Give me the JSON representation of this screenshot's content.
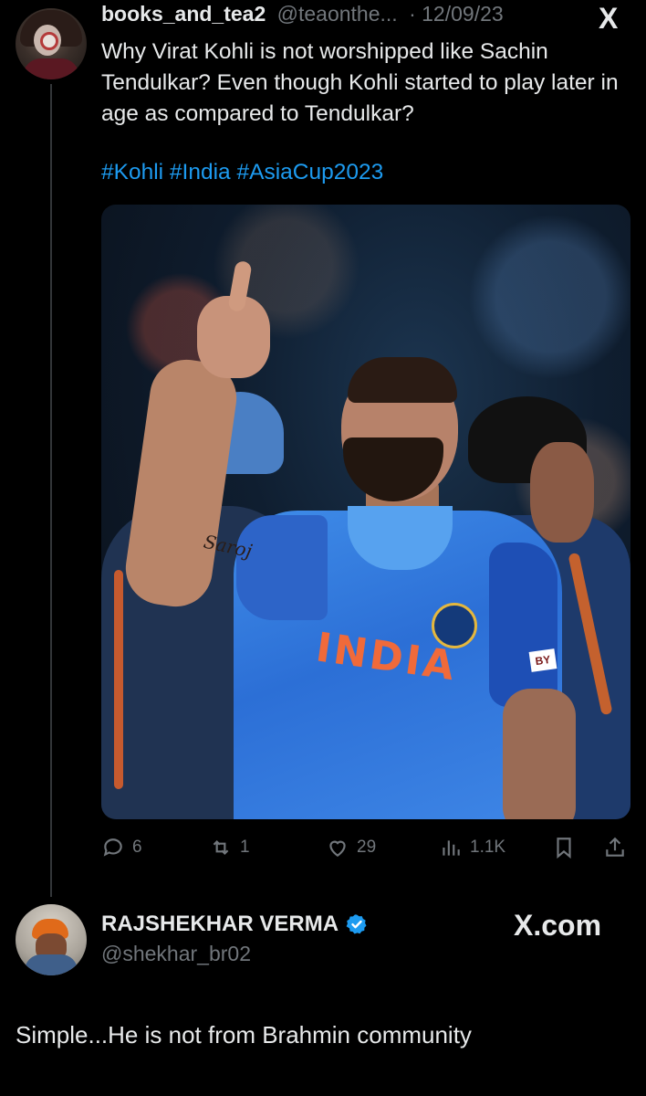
{
  "tweet": {
    "author_name": "books_and_tea2",
    "author_handle": "@teaonthe...",
    "date": "· 12/09/23",
    "close_label": "X",
    "text": "Why Virat Kohli is not worshipped like Sachin Tendulkar? Even though Kohli started to play later in age as compared to Tendulkar?",
    "hashtags": "#Kohli #India #AsiaCup2023",
    "image": {
      "jersey_text": "INDIA",
      "tattoo_text": "Saroj",
      "sleeve_logo_text": "BY"
    },
    "actions": {
      "replies": "6",
      "reposts": "1",
      "likes": "29",
      "views": "1.1K"
    }
  },
  "reply": {
    "author_name": "RAJSHEKHAR VERMA",
    "author_handle": "@shekhar_br02",
    "watermark": "X.com",
    "text": "Simple...He is not from Brahmin community"
  },
  "colors": {
    "background": "#000000",
    "text": "#e7e9ea",
    "muted": "#71767b",
    "link": "#1d9bf0"
  }
}
